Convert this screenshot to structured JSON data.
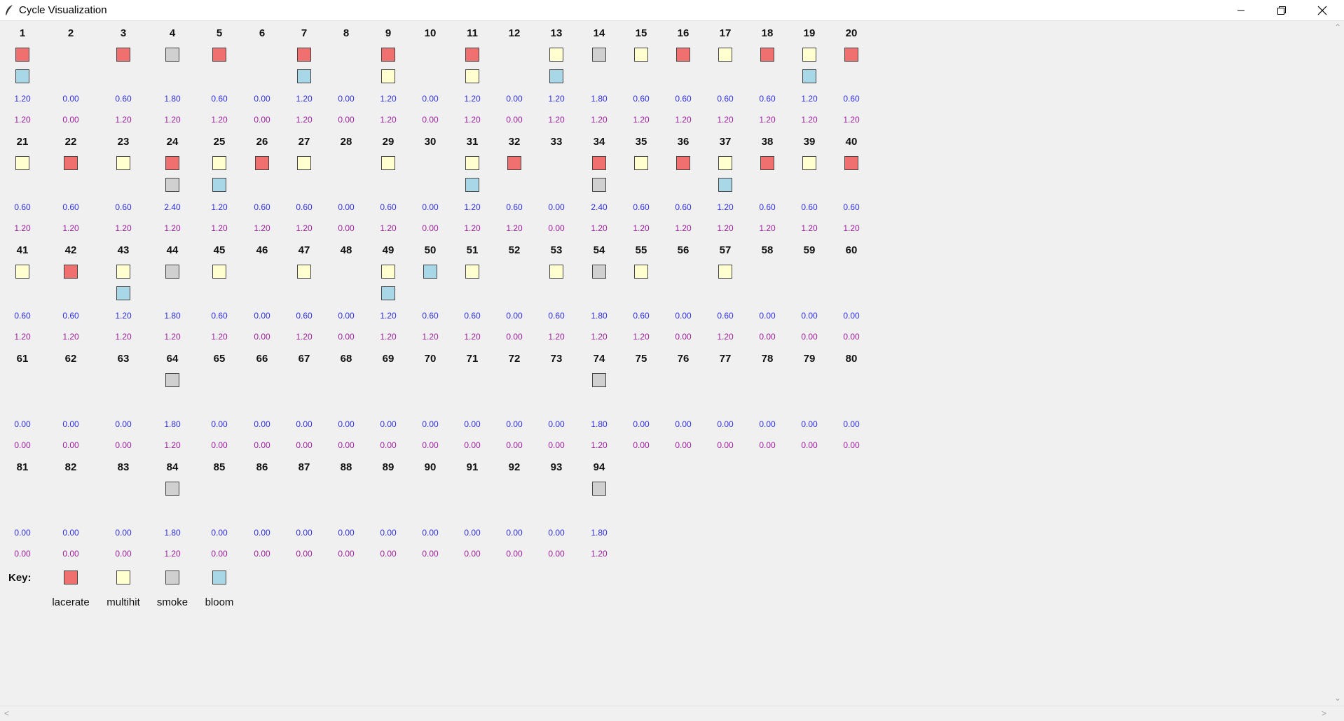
{
  "window": {
    "title": "Cycle Visualization",
    "minimize_icon": "minimize-icon",
    "maximize_icon": "restore-icon",
    "close_icon": "close-icon"
  },
  "colors": {
    "lacerate": "#f07070",
    "multihit": "#ffffd0",
    "smoke": "#d0d0d0",
    "bloom": "#a8d8e8",
    "value1": "#2f2fe0",
    "value2": "#9d1f9d"
  },
  "cycles": [
    {
      "n": "1",
      "s": [
        "lacerate",
        "bloom"
      ],
      "v1": "1.20",
      "v2": "1.20"
    },
    {
      "n": "2",
      "s": [],
      "v1": "0.00",
      "v2": "0.00"
    },
    {
      "n": "3",
      "s": [
        "lacerate"
      ],
      "v1": "0.60",
      "v2": "1.20"
    },
    {
      "n": "4",
      "s": [
        "smoke"
      ],
      "v1": "1.80",
      "v2": "1.20"
    },
    {
      "n": "5",
      "s": [
        "lacerate"
      ],
      "v1": "0.60",
      "v2": "1.20"
    },
    {
      "n": "6",
      "s": [],
      "v1": "0.00",
      "v2": "0.00"
    },
    {
      "n": "7",
      "s": [
        "lacerate",
        "bloom"
      ],
      "v1": "1.20",
      "v2": "1.20"
    },
    {
      "n": "8",
      "s": [],
      "v1": "0.00",
      "v2": "0.00"
    },
    {
      "n": "9",
      "s": [
        "lacerate",
        "multihit"
      ],
      "v1": "1.20",
      "v2": "1.20"
    },
    {
      "n": "10",
      "s": [],
      "v1": "0.00",
      "v2": "0.00"
    },
    {
      "n": "11",
      "s": [
        "lacerate",
        "multihit"
      ],
      "v1": "1.20",
      "v2": "1.20"
    },
    {
      "n": "12",
      "s": [],
      "v1": "0.00",
      "v2": "0.00"
    },
    {
      "n": "13",
      "s": [
        "multihit",
        "bloom"
      ],
      "v1": "1.20",
      "v2": "1.20"
    },
    {
      "n": "14",
      "s": [
        "smoke"
      ],
      "v1": "1.80",
      "v2": "1.20"
    },
    {
      "n": "15",
      "s": [
        "multihit"
      ],
      "v1": "0.60",
      "v2": "1.20"
    },
    {
      "n": "16",
      "s": [
        "lacerate"
      ],
      "v1": "0.60",
      "v2": "1.20"
    },
    {
      "n": "17",
      "s": [
        "multihit"
      ],
      "v1": "0.60",
      "v2": "1.20"
    },
    {
      "n": "18",
      "s": [
        "lacerate"
      ],
      "v1": "0.60",
      "v2": "1.20"
    },
    {
      "n": "19",
      "s": [
        "multihit",
        "bloom"
      ],
      "v1": "1.20",
      "v2": "1.20"
    },
    {
      "n": "20",
      "s": [
        "lacerate"
      ],
      "v1": "0.60",
      "v2": "1.20"
    },
    {
      "n": "21",
      "s": [
        "multihit"
      ],
      "v1": "0.60",
      "v2": "1.20"
    },
    {
      "n": "22",
      "s": [
        "lacerate"
      ],
      "v1": "0.60",
      "v2": "1.20"
    },
    {
      "n": "23",
      "s": [
        "multihit"
      ],
      "v1": "0.60",
      "v2": "1.20"
    },
    {
      "n": "24",
      "s": [
        "lacerate",
        "smoke"
      ],
      "v1": "2.40",
      "v2": "1.20"
    },
    {
      "n": "25",
      "s": [
        "multihit",
        "bloom"
      ],
      "v1": "1.20",
      "v2": "1.20"
    },
    {
      "n": "26",
      "s": [
        "lacerate"
      ],
      "v1": "0.60",
      "v2": "1.20"
    },
    {
      "n": "27",
      "s": [
        "multihit"
      ],
      "v1": "0.60",
      "v2": "1.20"
    },
    {
      "n": "28",
      "s": [],
      "v1": "0.00",
      "v2": "0.00"
    },
    {
      "n": "29",
      "s": [
        "multihit"
      ],
      "v1": "0.60",
      "v2": "1.20"
    },
    {
      "n": "30",
      "s": [],
      "v1": "0.00",
      "v2": "0.00"
    },
    {
      "n": "31",
      "s": [
        "multihit",
        "bloom"
      ],
      "v1": "1.20",
      "v2": "1.20"
    },
    {
      "n": "32",
      "s": [
        "lacerate"
      ],
      "v1": "0.60",
      "v2": "1.20"
    },
    {
      "n": "33",
      "s": [],
      "v1": "0.00",
      "v2": "0.00"
    },
    {
      "n": "34",
      "s": [
        "lacerate",
        "smoke"
      ],
      "v1": "2.40",
      "v2": "1.20"
    },
    {
      "n": "35",
      "s": [
        "multihit"
      ],
      "v1": "0.60",
      "v2": "1.20"
    },
    {
      "n": "36",
      "s": [
        "lacerate"
      ],
      "v1": "0.60",
      "v2": "1.20"
    },
    {
      "n": "37",
      "s": [
        "multihit",
        "bloom"
      ],
      "v1": "1.20",
      "v2": "1.20"
    },
    {
      "n": "38",
      "s": [
        "lacerate"
      ],
      "v1": "0.60",
      "v2": "1.20"
    },
    {
      "n": "39",
      "s": [
        "multihit"
      ],
      "v1": "0.60",
      "v2": "1.20"
    },
    {
      "n": "40",
      "s": [
        "lacerate"
      ],
      "v1": "0.60",
      "v2": "1.20"
    },
    {
      "n": "41",
      "s": [
        "multihit"
      ],
      "v1": "0.60",
      "v2": "1.20"
    },
    {
      "n": "42",
      "s": [
        "lacerate"
      ],
      "v1": "0.60",
      "v2": "1.20"
    },
    {
      "n": "43",
      "s": [
        "multihit",
        "bloom"
      ],
      "v1": "1.20",
      "v2": "1.20"
    },
    {
      "n": "44",
      "s": [
        "smoke"
      ],
      "v1": "1.80",
      "v2": "1.20"
    },
    {
      "n": "45",
      "s": [
        "multihit"
      ],
      "v1": "0.60",
      "v2": "1.20"
    },
    {
      "n": "46",
      "s": [],
      "v1": "0.00",
      "v2": "0.00"
    },
    {
      "n": "47",
      "s": [
        "multihit"
      ],
      "v1": "0.60",
      "v2": "1.20"
    },
    {
      "n": "48",
      "s": [],
      "v1": "0.00",
      "v2": "0.00"
    },
    {
      "n": "49",
      "s": [
        "multihit",
        "bloom"
      ],
      "v1": "1.20",
      "v2": "1.20"
    },
    {
      "n": "50",
      "s": [
        "bloom"
      ],
      "v1": "0.60",
      "v2": "1.20"
    },
    {
      "n": "51",
      "s": [
        "multihit"
      ],
      "v1": "0.60",
      "v2": "1.20"
    },
    {
      "n": "52",
      "s": [],
      "v1": "0.00",
      "v2": "0.00"
    },
    {
      "n": "53",
      "s": [
        "multihit"
      ],
      "v1": "0.60",
      "v2": "1.20"
    },
    {
      "n": "54",
      "s": [
        "smoke"
      ],
      "v1": "1.80",
      "v2": "1.20"
    },
    {
      "n": "55",
      "s": [
        "multihit"
      ],
      "v1": "0.60",
      "v2": "1.20"
    },
    {
      "n": "56",
      "s": [],
      "v1": "0.00",
      "v2": "0.00"
    },
    {
      "n": "57",
      "s": [
        "multihit"
      ],
      "v1": "0.60",
      "v2": "1.20"
    },
    {
      "n": "58",
      "s": [],
      "v1": "0.00",
      "v2": "0.00"
    },
    {
      "n": "59",
      "s": [],
      "v1": "0.00",
      "v2": "0.00"
    },
    {
      "n": "60",
      "s": [],
      "v1": "0.00",
      "v2": "0.00"
    },
    {
      "n": "61",
      "s": [],
      "v1": "0.00",
      "v2": "0.00"
    },
    {
      "n": "62",
      "s": [],
      "v1": "0.00",
      "v2": "0.00"
    },
    {
      "n": "63",
      "s": [],
      "v1": "0.00",
      "v2": "0.00"
    },
    {
      "n": "64",
      "s": [
        "smoke"
      ],
      "v1": "1.80",
      "v2": "1.20"
    },
    {
      "n": "65",
      "s": [],
      "v1": "0.00",
      "v2": "0.00"
    },
    {
      "n": "66",
      "s": [],
      "v1": "0.00",
      "v2": "0.00"
    },
    {
      "n": "67",
      "s": [],
      "v1": "0.00",
      "v2": "0.00"
    },
    {
      "n": "68",
      "s": [],
      "v1": "0.00",
      "v2": "0.00"
    },
    {
      "n": "69",
      "s": [],
      "v1": "0.00",
      "v2": "0.00"
    },
    {
      "n": "70",
      "s": [],
      "v1": "0.00",
      "v2": "0.00"
    },
    {
      "n": "71",
      "s": [],
      "v1": "0.00",
      "v2": "0.00"
    },
    {
      "n": "72",
      "s": [],
      "v1": "0.00",
      "v2": "0.00"
    },
    {
      "n": "73",
      "s": [],
      "v1": "0.00",
      "v2": "0.00"
    },
    {
      "n": "74",
      "s": [
        "smoke"
      ],
      "v1": "1.80",
      "v2": "1.20"
    },
    {
      "n": "75",
      "s": [],
      "v1": "0.00",
      "v2": "0.00"
    },
    {
      "n": "76",
      "s": [],
      "v1": "0.00",
      "v2": "0.00"
    },
    {
      "n": "77",
      "s": [],
      "v1": "0.00",
      "v2": "0.00"
    },
    {
      "n": "78",
      "s": [],
      "v1": "0.00",
      "v2": "0.00"
    },
    {
      "n": "79",
      "s": [],
      "v1": "0.00",
      "v2": "0.00"
    },
    {
      "n": "80",
      "s": [],
      "v1": "0.00",
      "v2": "0.00"
    },
    {
      "n": "81",
      "s": [],
      "v1": "0.00",
      "v2": "0.00"
    },
    {
      "n": "82",
      "s": [],
      "v1": "0.00",
      "v2": "0.00"
    },
    {
      "n": "83",
      "s": [],
      "v1": "0.00",
      "v2": "0.00"
    },
    {
      "n": "84",
      "s": [
        "smoke"
      ],
      "v1": "1.80",
      "v2": "1.20"
    },
    {
      "n": "85",
      "s": [],
      "v1": "0.00",
      "v2": "0.00"
    },
    {
      "n": "86",
      "s": [],
      "v1": "0.00",
      "v2": "0.00"
    },
    {
      "n": "87",
      "s": [],
      "v1": "0.00",
      "v2": "0.00"
    },
    {
      "n": "88",
      "s": [],
      "v1": "0.00",
      "v2": "0.00"
    },
    {
      "n": "89",
      "s": [],
      "v1": "0.00",
      "v2": "0.00"
    },
    {
      "n": "90",
      "s": [],
      "v1": "0.00",
      "v2": "0.00"
    },
    {
      "n": "91",
      "s": [],
      "v1": "0.00",
      "v2": "0.00"
    },
    {
      "n": "92",
      "s": [],
      "v1": "0.00",
      "v2": "0.00"
    },
    {
      "n": "93",
      "s": [],
      "v1": "0.00",
      "v2": "0.00"
    },
    {
      "n": "94",
      "s": [
        "smoke"
      ],
      "v1": "1.80",
      "v2": "1.20"
    }
  ],
  "key": {
    "label": "Key:",
    "items": [
      {
        "name": "lacerate",
        "label": "lacerate"
      },
      {
        "name": "multihit",
        "label": "multihit"
      },
      {
        "name": "smoke",
        "label": "smoke"
      },
      {
        "name": "bloom",
        "label": "bloom"
      }
    ]
  }
}
